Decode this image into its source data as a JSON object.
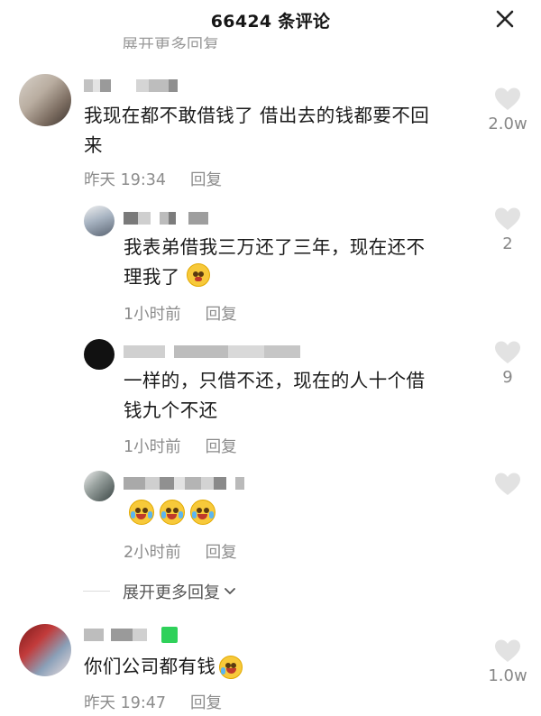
{
  "header": {
    "title": "66424 条评论"
  },
  "clipped_top_link": "展开更多回复",
  "comments": [
    {
      "text_line1": "我现在都不敢借钱了 借出去的钱都要不回",
      "text_line2": "来",
      "time": "昨天 19:34",
      "reply_label": "回复",
      "likes": "2.0w"
    },
    {
      "text_line1": "我表弟借我三万还了三年，现在还不",
      "text_line2": "理我了",
      "time": "1小时前",
      "reply_label": "回复",
      "likes": "2"
    },
    {
      "text_line1": "一样的，只借不还，现在的人十个借",
      "text_line2": "钱九个不还",
      "time": "1小时前",
      "reply_label": "回复",
      "likes": "9"
    },
    {
      "text_line1": "",
      "time": "2小时前",
      "reply_label": "回复",
      "likes": ""
    },
    {
      "text_line1": "你们公司都有钱",
      "time": "昨天 19:47",
      "reply_label": "回复",
      "likes": "1.0w"
    }
  ],
  "expand_more": "展开更多回复",
  "colors": {
    "text": "#1b1b1b",
    "meta": "#8c8c8c",
    "heart": "#e2e2e2",
    "green_badge": "#2fd15a"
  },
  "icons": [
    "close-icon",
    "heart-icon",
    "chevron-down-icon",
    "emoji-icon"
  ]
}
